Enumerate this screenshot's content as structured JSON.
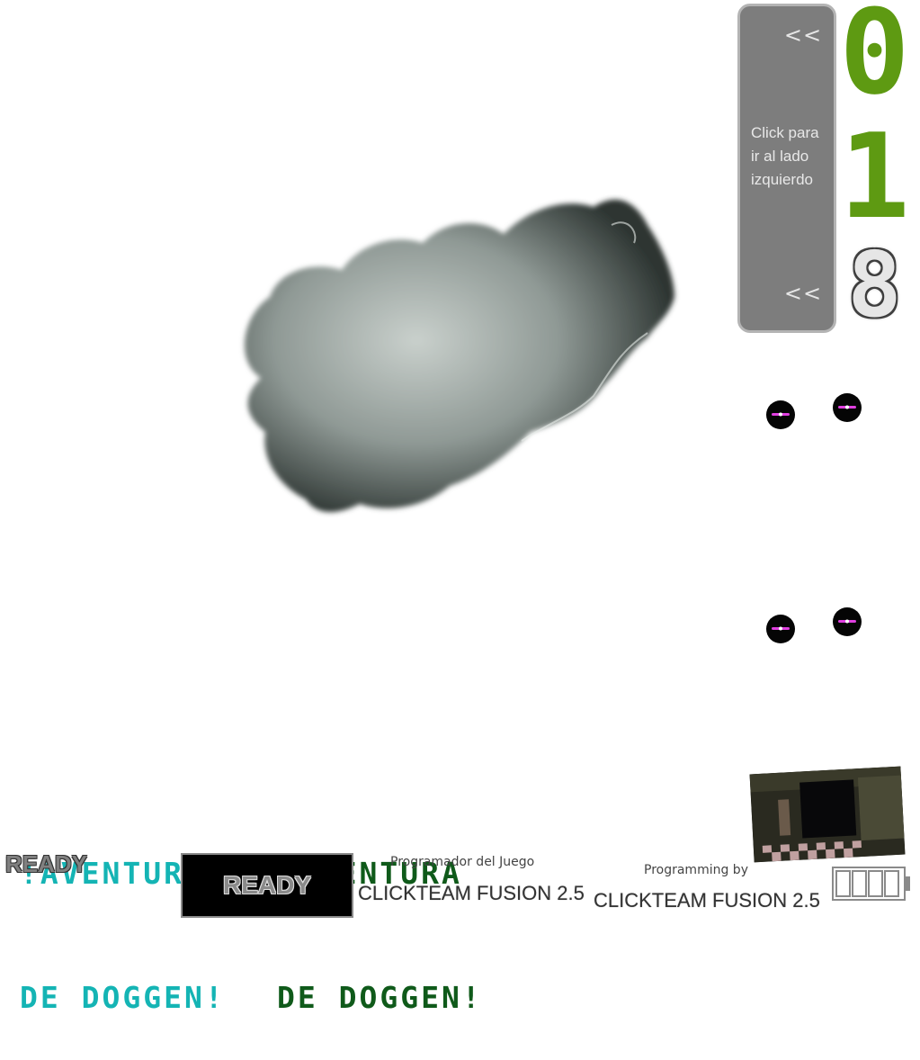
{
  "side_panel": {
    "arrow_top": "<<",
    "arrow_bottom": "<<",
    "text_line1": "Click para",
    "text_line2": "ir al lado",
    "text_line3": "izquierdo"
  },
  "counter": {
    "digits": [
      "0",
      "1",
      "8"
    ]
  },
  "titles": {
    "cyan_line1": "!AVENTURA",
    "cyan_line2": "DE DOGGEN!",
    "green_line1": "!AVENTURA",
    "green_line2": "DE DOGGEN!"
  },
  "ready": {
    "small_label": "READY",
    "button_label": "READY"
  },
  "credits": {
    "es_label": "Programador del Juego",
    "es_engine": "CLICKTEAM FUSION 2.5",
    "en_label": "Programming by",
    "en_engine": "CLICKTEAM FUSION 2.5"
  },
  "colors": {
    "counter_green": "#5e9a12",
    "title_cyan": "#14b4b4",
    "title_green": "#0f5a1a",
    "eye_glow": "#e040e0"
  },
  "icons": {
    "eyes": "glowing-eyes",
    "battery": "battery-icon"
  }
}
